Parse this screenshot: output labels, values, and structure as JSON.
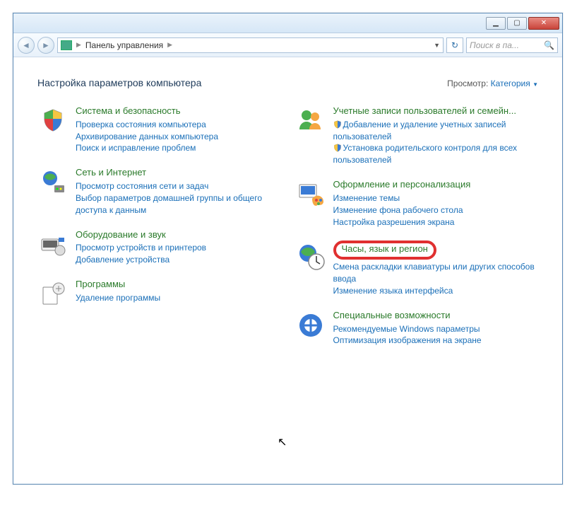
{
  "address": {
    "label": "Панель управления"
  },
  "search": {
    "placeholder": "Поиск в па..."
  },
  "heading": "Настройка параметров компьютера",
  "viewby": {
    "label": "Просмотр:",
    "value": "Категория"
  },
  "left": [
    {
      "title": "Система и безопасность",
      "links": [
        {
          "text": "Проверка состояния компьютера"
        },
        {
          "text": "Архивирование данных компьютера"
        },
        {
          "text": "Поиск и исправление проблем"
        }
      ]
    },
    {
      "title": "Сеть и Интернет",
      "links": [
        {
          "text": "Просмотр состояния сети и задач"
        },
        {
          "text": "Выбор параметров домашней группы и общего доступа к данным"
        }
      ]
    },
    {
      "title": "Оборудование и звук",
      "links": [
        {
          "text": "Просмотр устройств и принтеров"
        },
        {
          "text": "Добавление устройства"
        }
      ]
    },
    {
      "title": "Программы",
      "links": [
        {
          "text": "Удаление программы"
        }
      ]
    }
  ],
  "right": [
    {
      "title": "Учетные записи пользователей и семейн...",
      "links": [
        {
          "text": "Добавление и удаление учетных записей пользователей",
          "shield": true
        },
        {
          "text": "Установка родительского контроля для всех пользователей",
          "shield": true
        }
      ]
    },
    {
      "title": "Оформление и персонализация",
      "links": [
        {
          "text": "Изменение темы"
        },
        {
          "text": "Изменение фона рабочего стола"
        },
        {
          "text": "Настройка разрешения экрана"
        }
      ]
    },
    {
      "title": "Часы, язык и регион",
      "highlight": true,
      "links": [
        {
          "text": "Смена раскладки клавиатуры или других способов ввода"
        },
        {
          "text": "Изменение языка интерфейса"
        }
      ]
    },
    {
      "title": "Специальные возможности",
      "links": [
        {
          "text": "Рекомендуемые Windows параметры"
        },
        {
          "text": "Оптимизация изображения на экране"
        }
      ]
    }
  ]
}
